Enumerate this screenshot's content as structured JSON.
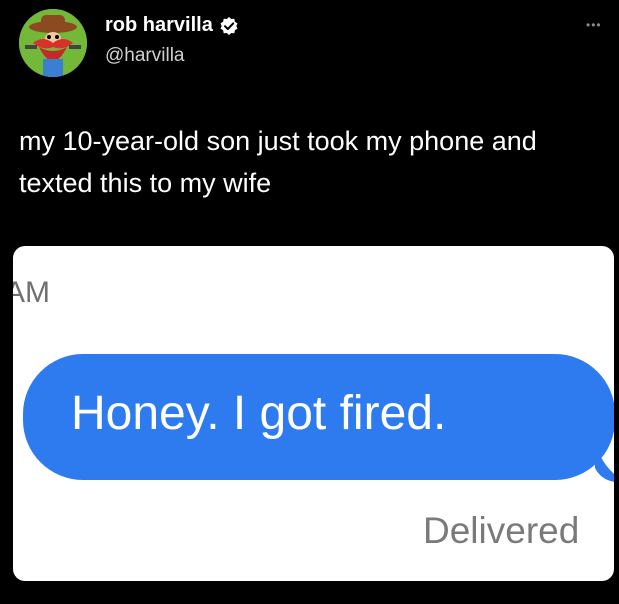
{
  "tweet": {
    "author": {
      "display_name": "rob harvilla",
      "handle": "@harvilla",
      "verified": true
    },
    "text": "my 10-year-old son just took my phone and texted this to my wife",
    "more_icon": "more-horizontal-icon"
  },
  "screenshot": {
    "timestamp_fragment": "AM",
    "message": "Honey. I got fired.",
    "status": "Delivered"
  },
  "colors": {
    "background": "#000000",
    "imessage_blue": "#2e7bf0",
    "avatar_green": "#74b83a"
  }
}
